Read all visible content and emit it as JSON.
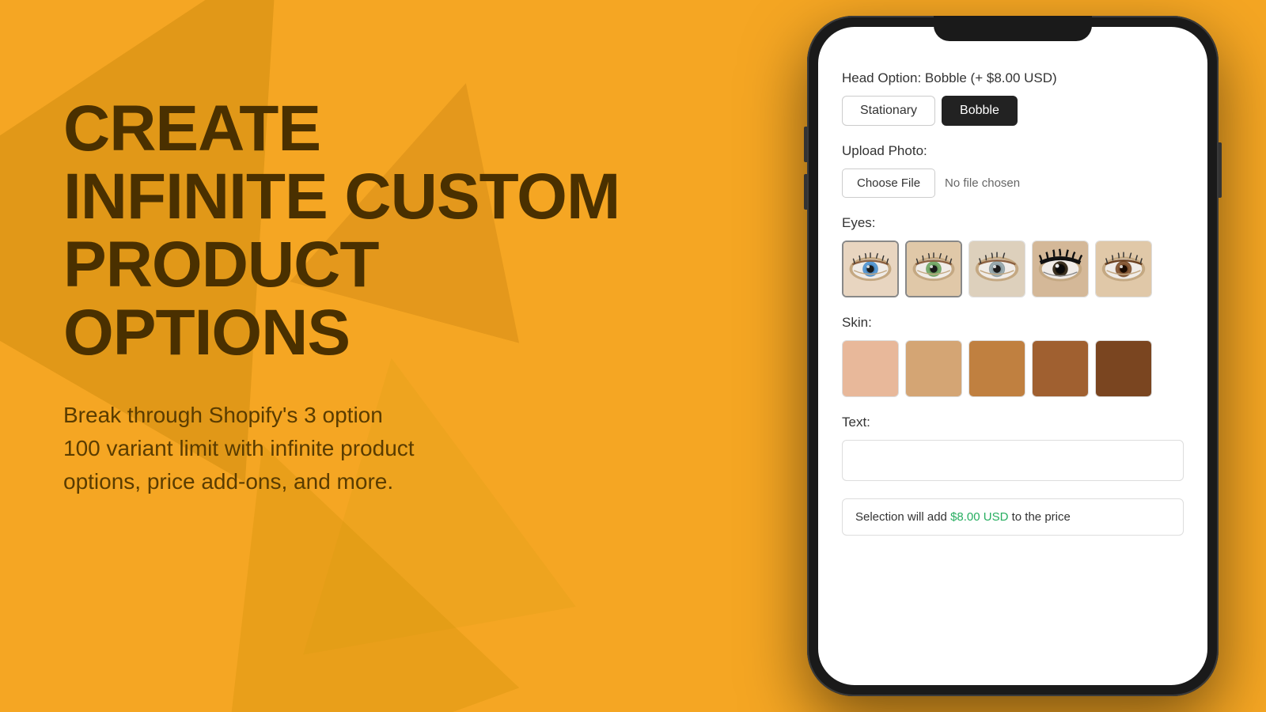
{
  "background": {
    "color": "#F5A623"
  },
  "left": {
    "headline_line1": "CREATE",
    "headline_line2": "INFINITE CUSTOM",
    "headline_line3": "PRODUCT OPTIONS",
    "subtext": "Break through Shopify's 3 option\n100 variant limit with infinite product\noptions, price add-ons, and more."
  },
  "phone": {
    "head_option_label": "Head Option:  Bobble  (+ $8.00 USD)",
    "head_options": [
      {
        "label": "Stationary",
        "active": false
      },
      {
        "label": "Bobble",
        "active": true
      }
    ],
    "upload_label": "Upload Photo:",
    "choose_file_label": "Choose File",
    "no_file_text": "No file chosen",
    "eyes_label": "Eyes:",
    "skin_label": "Skin:",
    "text_label": "Text:",
    "text_placeholder": "",
    "price_notice_prefix": "Selection will add ",
    "price_notice_amount": "$8.00 USD",
    "price_notice_suffix": " to the price",
    "skin_colors": [
      "#E8B89A",
      "#D4A574",
      "#C08040",
      "#A06030",
      "#7A4520"
    ],
    "eye_colors": [
      "blue",
      "green-hazel",
      "grey",
      "dark",
      "brown"
    ]
  }
}
